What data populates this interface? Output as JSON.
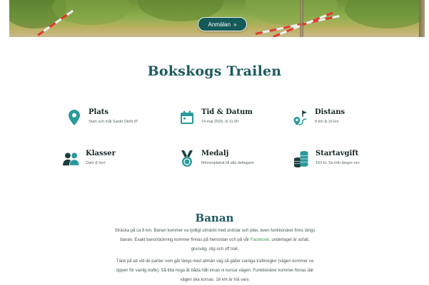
{
  "hero": {
    "cta_label": "Anmälan",
    "cta_chevron": "»"
  },
  "page": {
    "title": "Bokskogs Trailen"
  },
  "info_items": [
    {
      "icon": "location-pin-icon",
      "title": "Plats",
      "subtitle": "Start och mål Sankt Olofs IP"
    },
    {
      "icon": "calendar-icon",
      "title": "Tid & Datum",
      "subtitle": "14 maj 2026, kl 11.00"
    },
    {
      "icon": "route-flag-icon",
      "title": "Distans",
      "subtitle": "8 km & 16 km"
    },
    {
      "icon": "people-icon",
      "title": "Klasser",
      "subtitle": "Dam & herr"
    },
    {
      "icon": "medal-icon",
      "title": "Medalj",
      "subtitle": "Minnesplakat till alla deltagare"
    },
    {
      "icon": "coins-icon",
      "title": "Startavgift",
      "subtitle": "150 kr. Se info längre ner."
    }
  ],
  "banan": {
    "title": "Banan",
    "p1_before": "Sträcka på ca 8 km. Banan kommer va tydligt utmärkt med snitslar och pilar, även funktionärer finns längs banan. Exakt bansträckning kommer finnas på hemsidan och på vår ",
    "p1_link": "Facebook",
    "p1_after": ", underlaget är asfalt, grusväg, stig och off trail.",
    "p2": "Tänk på att vid de partier som går längs med allmän väg så gäller vanliga trafikregler (vägen kommer va öppen för vanlig trafik). Så titta noga åt båda håll innan ni korsar vägen. Funktionärer kommer finnas där vägen ska korsas. 16 km är två varv."
  },
  "colors": {
    "accent": "#1e5a60",
    "icon": "#2a9a9c",
    "cta_bg": "#145a58",
    "link": "#3a9a52"
  }
}
